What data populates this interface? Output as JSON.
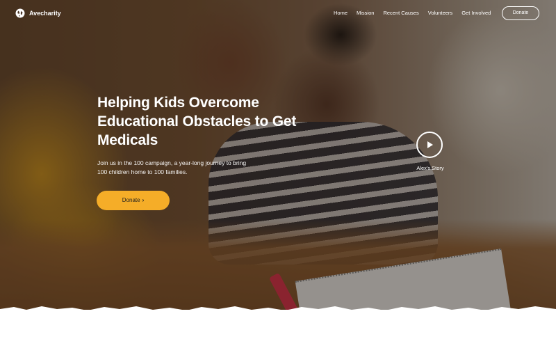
{
  "brand": {
    "name": "Avecharity",
    "logo_icon": "globe-leaf-icon"
  },
  "nav": {
    "links": [
      "Home",
      "Mission",
      "Recent Causes",
      "Volunteers",
      "Get Involved"
    ],
    "donate_label": "Donate"
  },
  "hero": {
    "title": "Helping Kids Overcome Educational Obstacles to Get Medicals",
    "subtitle": "Join us in the 100 campaign, a year-long journey to bring 100 children home to 100 families.",
    "donate_label": "Donate",
    "donate_icon": "chevron-right-icon",
    "video": {
      "icon": "play-icon",
      "label": "Alex's Story"
    }
  },
  "colors": {
    "accent": "#f5ad28",
    "text_light": "#ffffff",
    "page_bg": "#ffffff"
  }
}
